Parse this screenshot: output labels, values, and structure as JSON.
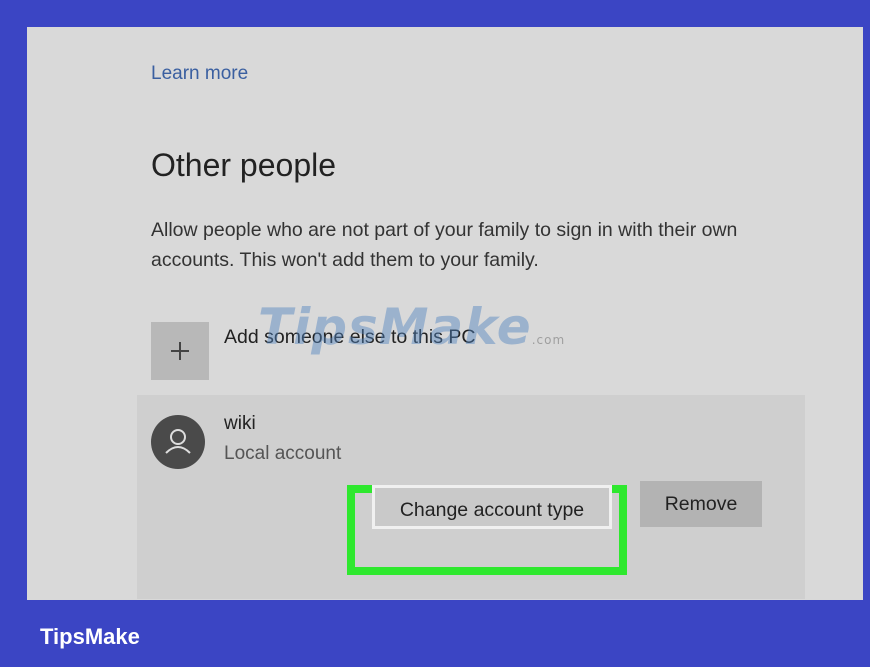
{
  "header": {
    "learn_more": "Learn more"
  },
  "section": {
    "title": "Other people",
    "description": "Allow people who are not part of your family to sign in with their own accounts. This won't add them to your family."
  },
  "add_person": {
    "label": "Add someone else to this PC",
    "icon": "plus-icon"
  },
  "user": {
    "name": "wiki",
    "account_type": "Local account",
    "avatar_icon": "person-icon"
  },
  "actions": {
    "change_account_type": "Change account type",
    "remove": "Remove"
  },
  "highlight_color": "#2ee82e",
  "watermark": {
    "brand": "TipsMake",
    "suffix": ".com"
  },
  "footer": {
    "brand": "TipsMake",
    "background": "#3b45c4"
  }
}
